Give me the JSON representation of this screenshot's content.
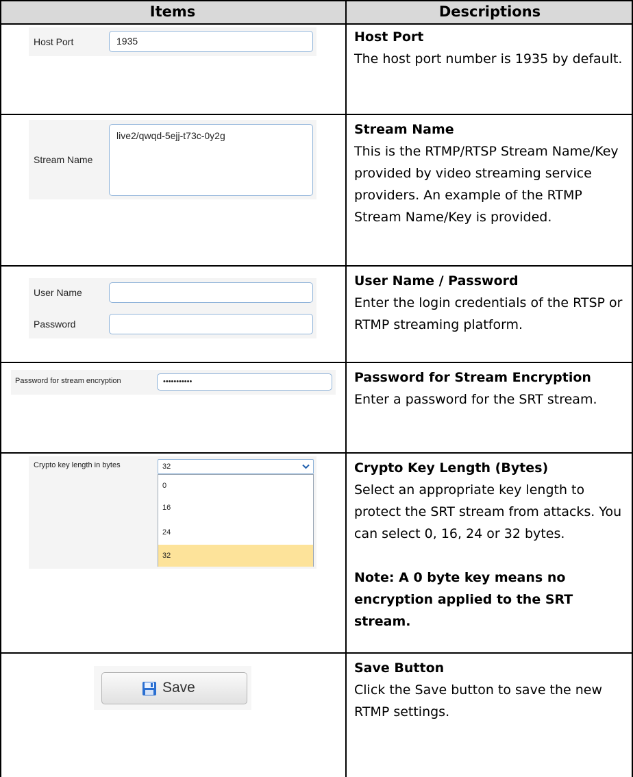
{
  "table": {
    "col_items": "Items",
    "col_descriptions": "Descriptions"
  },
  "rows": [
    {
      "ui": {
        "label": "Host Port",
        "value": "1935"
      },
      "title": "Host Port",
      "body": "The host port number is 1935 by default."
    },
    {
      "ui": {
        "label": "Stream Name",
        "value": "live2/qwqd-5ejj-t73c-0y2g"
      },
      "title": "Stream Name",
      "body": "This is the RTMP/RTSP Stream Name/Key provided by video streaming service providers. An example of the RTMP Stream Name/Key is provided."
    },
    {
      "ui": {
        "label_user": "User Name",
        "label_password": "Password"
      },
      "title": "User Name / Password",
      "body": "Enter the login credentials of the RTSP or RTMP streaming platform."
    },
    {
      "ui": {
        "label": "Password for stream encryption",
        "value": "•••••••••••"
      },
      "title": "Password for Stream Encryption",
      "body": "Enter a password for the SRT stream."
    },
    {
      "ui": {
        "label": "Crypto key length in bytes",
        "selected": "32",
        "options": [
          "0",
          "16",
          "24",
          "32"
        ]
      },
      "title": "Crypto Key Length (Bytes)",
      "body": "Select an appropriate key length to protect the SRT stream from attacks. You can select 0, 16, 24 or 32 bytes.",
      "note": "Note: A 0 byte key means no encryption applied to the SRT stream."
    },
    {
      "ui": {
        "button_label": "Save"
      },
      "title": "Save Button",
      "body": "Click the Save button to save the new RTMP settings."
    }
  ],
  "icons": {
    "save": "floppy-disk-icon",
    "dropdown": "chevron-down-icon"
  },
  "colors": {
    "header_bg": "#d9d9d9",
    "field_border": "#8fb3d9",
    "selected_option": "#fde39a",
    "save_icon": "#2a6fd1"
  }
}
